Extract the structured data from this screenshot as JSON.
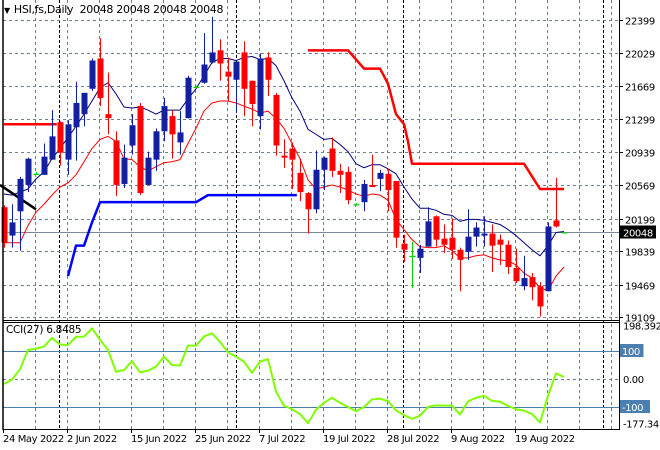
{
  "header": {
    "symbol": "HSI,fs,Daily",
    "open": "20048",
    "high": "20048",
    "low": "20048",
    "close": "20048"
  },
  "cci_label": {
    "name": "CCI(27)",
    "value": "6.8485"
  },
  "colors": {
    "bull": "#1020a0",
    "bear": "#ff0000",
    "doji": "#00d000",
    "ma_fast": "#000080",
    "ma_slow": "#ff0000",
    "upper_band": "#ff0000",
    "lower_band": "#0000ff",
    "trendline": "#000000",
    "cci": "#80ff00",
    "grid": "#708090",
    "level_box": "#4a7fb0"
  },
  "chart_data": [
    {
      "type": "candlestick",
      "title": "HSI,fs,Daily",
      "ylim": [
        19109,
        22399
      ],
      "price_ticks": [
        22399,
        22029,
        21669,
        21299,
        20939,
        20569,
        20199,
        19839,
        19469,
        19109
      ],
      "current_price": "20048",
      "date_labels": [
        {
          "bar": 0,
          "text": "24 May 2022"
        },
        {
          "bar": 8,
          "text": "2 Jun 2022"
        },
        {
          "bar": 16,
          "text": "15 Jun 2022"
        },
        {
          "bar": 24,
          "text": "25 Jun 2022"
        },
        {
          "bar": 32,
          "text": "7 Jul 2022"
        },
        {
          "bar": 40,
          "text": "19 Jul 2022"
        },
        {
          "bar": 48,
          "text": "28 Jul 2022"
        },
        {
          "bar": 56,
          "text": "9 Aug 2022"
        },
        {
          "bar": 64,
          "text": "19 Aug 2022"
        }
      ],
      "ohlc_fields": [
        "open",
        "high",
        "low",
        "close"
      ],
      "candles": [
        [
          20325,
          20347,
          19877,
          19932
        ],
        [
          20011,
          20358,
          19877,
          20157
        ],
        [
          20280,
          20661,
          19843,
          20639
        ],
        [
          20572,
          20874,
          20493,
          20863
        ],
        [
          20695,
          20717,
          20684,
          20695
        ],
        [
          20684,
          21031,
          20684,
          20885
        ],
        [
          20852,
          21401,
          20852,
          21110
        ],
        [
          21267,
          21278,
          20784,
          20930
        ],
        [
          20852,
          21289,
          20684,
          21244
        ],
        [
          21211,
          21715,
          20841,
          21480
        ],
        [
          21356,
          21592,
          21222,
          21592
        ],
        [
          21637,
          21973,
          21614,
          21950
        ],
        [
          21973,
          22197,
          21446,
          21536
        ],
        [
          21356,
          21816,
          21132,
          21311
        ],
        [
          21065,
          21166,
          20448,
          20572
        ],
        [
          20583,
          21020,
          20538,
          20874
        ],
        [
          21009,
          21356,
          20908,
          21233
        ],
        [
          21446,
          21480,
          20459,
          20482
        ],
        [
          20572,
          20941,
          20572,
          20874
        ],
        [
          20852,
          21199,
          20728,
          21166
        ],
        [
          21166,
          21536,
          21054,
          21446
        ],
        [
          21334,
          21401,
          20863,
          21132
        ],
        [
          21043,
          21390,
          20908,
          21154
        ],
        [
          21311,
          21782,
          21311,
          21760
        ],
        [
          21659,
          21670,
          21648,
          21659
        ],
        [
          21704,
          22253,
          21693,
          21906
        ],
        [
          21928,
          22433,
          21917,
          22040
        ],
        [
          22063,
          22186,
          21726,
          21917
        ],
        [
          21827,
          21984,
          21502,
          21771
        ],
        [
          21737,
          21939,
          21368,
          21939
        ],
        [
          22040,
          22164,
          21334,
          21637
        ],
        [
          21726,
          21726,
          21222,
          21468
        ],
        [
          21334,
          22029,
          21188,
          21973
        ],
        [
          21984,
          22040,
          21558,
          21737
        ],
        [
          21569,
          21592,
          20897,
          21009
        ],
        [
          20897,
          21076,
          20762,
          20874
        ],
        [
          20975,
          21043,
          20527,
          20852
        ],
        [
          20706,
          20863,
          20392,
          20493
        ],
        [
          20482,
          20493,
          20033,
          20302
        ],
        [
          20302,
          20953,
          20258,
          20740
        ],
        [
          20740,
          20885,
          20516,
          20874
        ],
        [
          20975,
          21098,
          20661,
          20728
        ],
        [
          20728,
          20807,
          20482,
          20684
        ],
        [
          20717,
          20773,
          20358,
          20403
        ],
        [
          20358,
          20370,
          20347,
          20358
        ],
        [
          20381,
          20628,
          20280,
          20583
        ],
        [
          20572,
          20908,
          20549,
          20549
        ],
        [
          20639,
          20740,
          20504,
          20706
        ],
        [
          20695,
          20751,
          20280,
          20516
        ],
        [
          20616,
          20616,
          19877,
          19988
        ],
        [
          19921,
          20022,
          19719,
          19854
        ],
        [
          19787,
          19944,
          19428,
          19787
        ],
        [
          19764,
          19910,
          19596,
          19865
        ],
        [
          19888,
          20325,
          19888,
          20168
        ],
        [
          20224,
          20235,
          19888,
          19966
        ],
        [
          19977,
          20134,
          19820,
          19910
        ],
        [
          19988,
          20201,
          19753,
          19854
        ],
        [
          19854,
          19877,
          19394,
          19742
        ],
        [
          19832,
          20302,
          19742,
          19999
        ],
        [
          19999,
          20157,
          19888,
          20100
        ],
        [
          20011,
          20224,
          19888,
          20033
        ],
        [
          20033,
          20134,
          19607,
          19899
        ],
        [
          19966,
          20022,
          19686,
          19910
        ],
        [
          19910,
          19955,
          19585,
          19663
        ],
        [
          19652,
          19865,
          19484,
          19506
        ],
        [
          19450,
          19787,
          19405,
          19540
        ],
        [
          19551,
          19596,
          19293,
          19439
        ],
        [
          19450,
          19495,
          19114,
          19226
        ],
        [
          19394,
          20157,
          19394,
          20112
        ],
        [
          20179,
          20650,
          20100,
          20112
        ],
        [
          20048,
          20048,
          20048,
          20048
        ]
      ],
      "series": [
        {
          "name": "ma_fast",
          "values": [
            20471,
            20459,
            20493,
            20527,
            20639,
            20717,
            20863,
            20975,
            21098,
            21222,
            21356,
            21502,
            21648,
            21704,
            21581,
            21435,
            21424,
            21435,
            21401,
            21356,
            21401,
            21401,
            21401,
            21525,
            21637,
            21782,
            21928,
            21973,
            21973,
            21950,
            21984,
            21995,
            21962,
            21973,
            21894,
            21726,
            21536,
            21390,
            21188,
            21132,
            21076,
            21087,
            21020,
            20941,
            20807,
            20762,
            20796,
            20796,
            20751,
            20695,
            20549,
            20415,
            20314,
            20314,
            20291,
            20246,
            20235,
            20168,
            20190,
            20190,
            20179,
            20157,
            20134,
            20078,
            20011,
            19932,
            19854,
            19787,
            19899,
            20045,
            20056
          ]
        },
        {
          "name": "ma_slow",
          "values": [
            19932,
            19932,
            19932,
            20123,
            20269,
            20358,
            20459,
            20549,
            20594,
            20684,
            20829,
            20975,
            21076,
            21110,
            21054,
            20863,
            20852,
            20773,
            20728,
            20773,
            20818,
            20829,
            20852,
            21031,
            21199,
            21390,
            21480,
            21502,
            21502,
            21480,
            21446,
            21412,
            21368,
            21390,
            21311,
            21199,
            21031,
            20863,
            20628,
            20527,
            20549,
            20572,
            20549,
            20516,
            20471,
            20448,
            20471,
            20459,
            20403,
            20190,
            20078,
            19966,
            19888,
            19877,
            19877,
            19899,
            19843,
            19764,
            19764,
            19787,
            19798,
            19764,
            19742,
            19731,
            19686,
            19596,
            19540,
            19428,
            19405,
            19562,
            19663
          ]
        },
        {
          "name": "upper_band_early",
          "points": [
            [
              0,
              21244
            ],
            [
              6.6,
              21244
            ]
          ]
        },
        {
          "name": "upper_band",
          "points": [
            [
              38,
              22063
            ],
            [
              43,
              22063
            ],
            [
              45,
              21861
            ],
            [
              47,
              21861
            ],
            [
              48,
              21693
            ],
            [
              49,
              21356
            ],
            [
              50,
              21244
            ],
            [
              50.5,
              21054
            ],
            [
              51,
              20807
            ],
            [
              65,
              20807
            ],
            [
              67,
              20527
            ],
            [
              70,
              20527
            ]
          ]
        },
        {
          "name": "lower_band",
          "points": [
            [
              8,
              19562
            ],
            [
              9,
              19899
            ],
            [
              10,
              19899
            ],
            [
              11,
              20157
            ],
            [
              12,
              20381
            ],
            [
              24,
              20381
            ],
            [
              25.5,
              20459
            ],
            [
              36.6,
              20459
            ]
          ]
        },
        {
          "name": "trendline",
          "points": [
            [
              -0.5,
              20572
            ],
            [
              4,
              20302
            ]
          ]
        }
      ]
    },
    {
      "type": "line",
      "title": "CCI(27)",
      "ylim": [
        -177.341,
        198.3924
      ],
      "tick_labels": {
        "max": "198.3924",
        "upper": "100",
        "zero": "0.00",
        "lower": "-100",
        "min": "-177.341"
      },
      "levels": [
        100,
        0,
        -100
      ],
      "values": [
        -18,
        -2,
        35,
        104,
        108,
        116,
        147,
        123,
        121,
        151,
        151,
        181,
        140,
        104,
        26,
        32,
        64,
        24,
        30,
        44,
        80,
        50,
        48,
        119,
        119,
        152,
        163,
        133,
        95,
        80,
        62,
        22,
        62,
        71,
        -45,
        -95,
        -108,
        -125,
        -158,
        -110,
        -85,
        -67,
        -85,
        -100,
        -115,
        -100,
        -73,
        -70,
        -79,
        -112,
        -129,
        -142,
        -131,
        -100,
        -94,
        -95,
        -95,
        -127,
        -80,
        -67,
        -60,
        -78,
        -81,
        -96,
        -108,
        -113,
        -125,
        -155,
        -60,
        20,
        6.8485
      ]
    }
  ]
}
